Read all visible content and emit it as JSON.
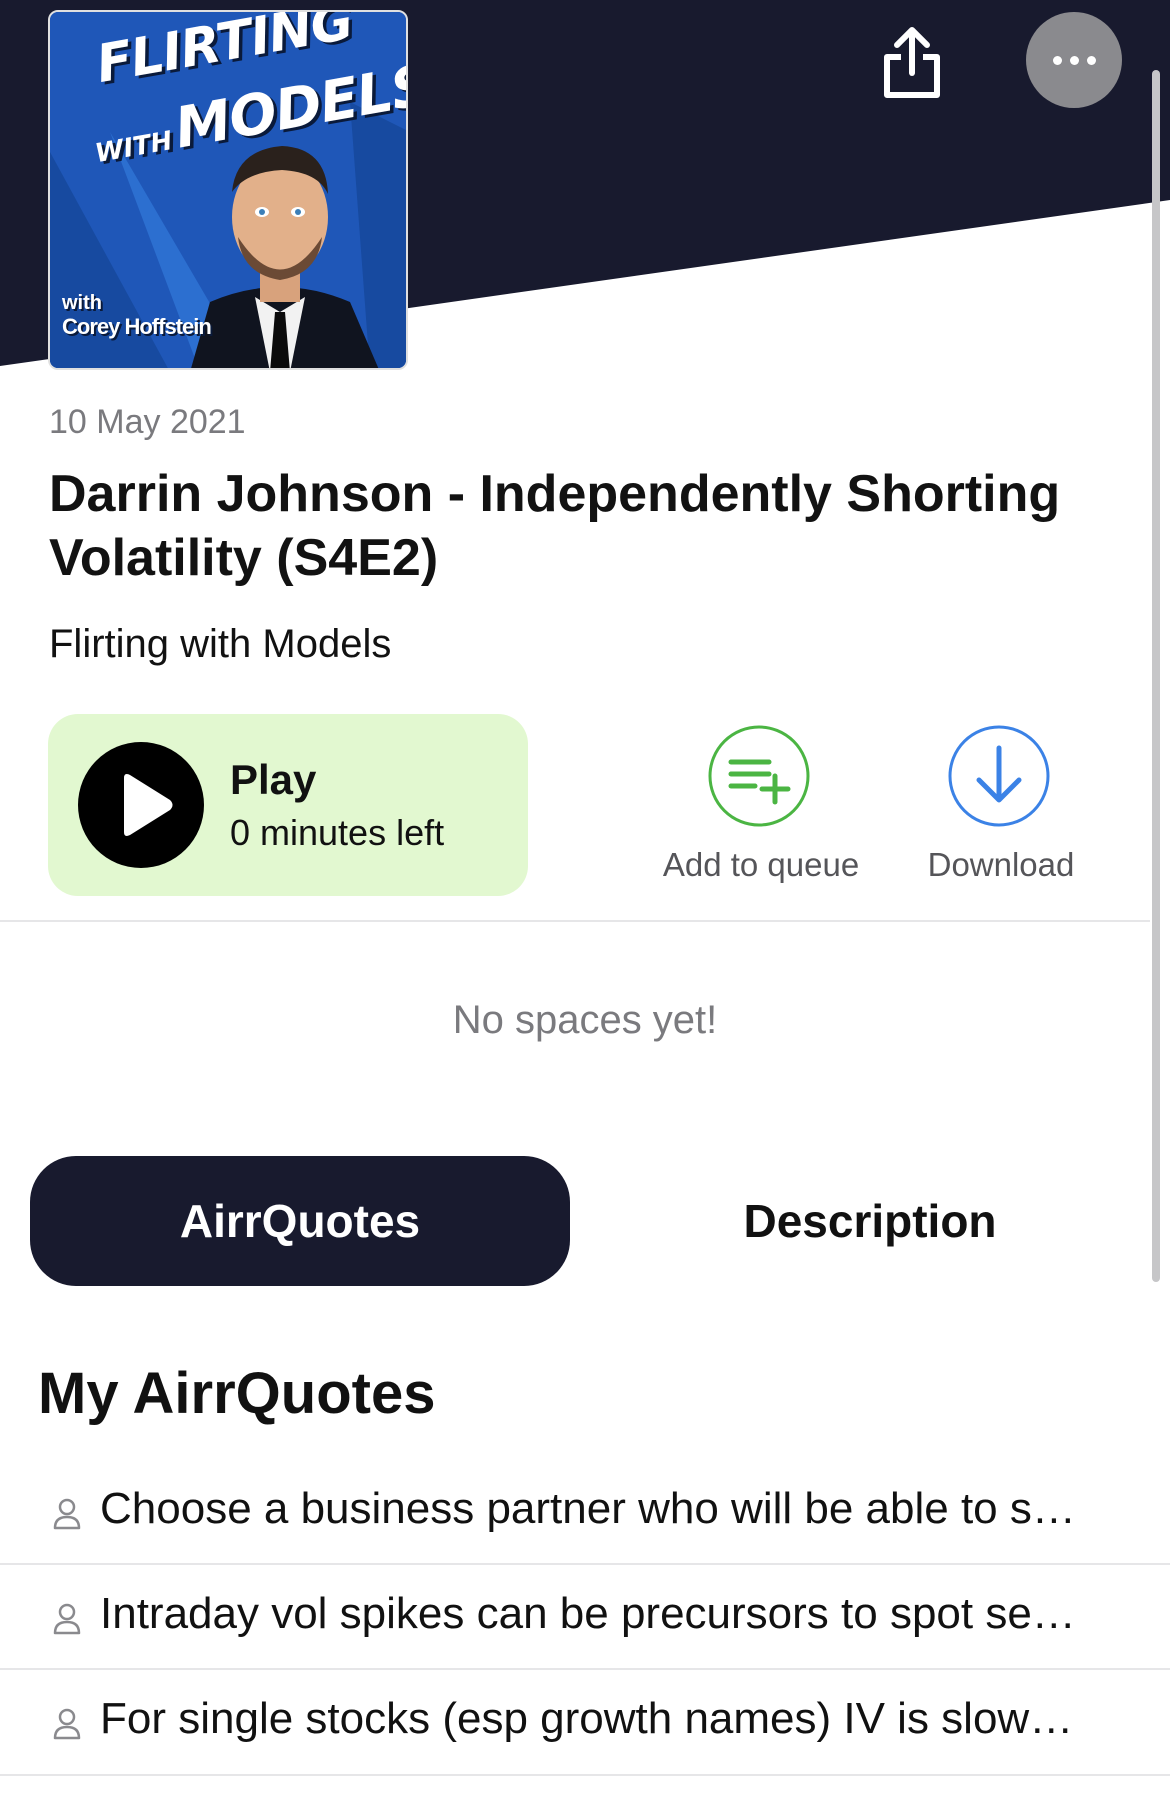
{
  "header": {
    "share_icon": "share-icon",
    "more_icon": "ellipsis-icon",
    "colors": {
      "header_bg": "#181a2e"
    }
  },
  "artwork": {
    "title_line1": "FLIRTING",
    "title_line2_small": "WITH",
    "title_line2_big": "MODELS",
    "with": "with",
    "host": "Corey Hoffstein"
  },
  "episode": {
    "date": "10 May 2021",
    "title": "Darrin Johnson - Independently Shorting Volatility (S4E2)",
    "show": "Flirting with Models"
  },
  "play": {
    "label": "Play",
    "remaining": "0 minutes left",
    "icon": "play-icon",
    "colors": {
      "card_bg": "#e2f8d0"
    }
  },
  "actions": {
    "add_to_queue": {
      "label": "Add to queue",
      "icon": "add-to-queue-icon",
      "color": "#4bb543"
    },
    "download": {
      "label": "Download",
      "icon": "download-icon",
      "color": "#3b82e6"
    }
  },
  "spaces": {
    "empty_message": "No spaces yet!"
  },
  "tabs": {
    "items": [
      {
        "label": "AirrQuotes",
        "active": true
      },
      {
        "label": "Description",
        "active": false
      }
    ]
  },
  "airrquotes": {
    "title": "My AirrQuotes",
    "items": [
      {
        "text": "Choose a business partner who will be able to s…"
      },
      {
        "text": "Intraday vol spikes can be precursors to spot se…"
      },
      {
        "text": "For single stocks (esp growth names) IV is slow…"
      }
    ]
  }
}
